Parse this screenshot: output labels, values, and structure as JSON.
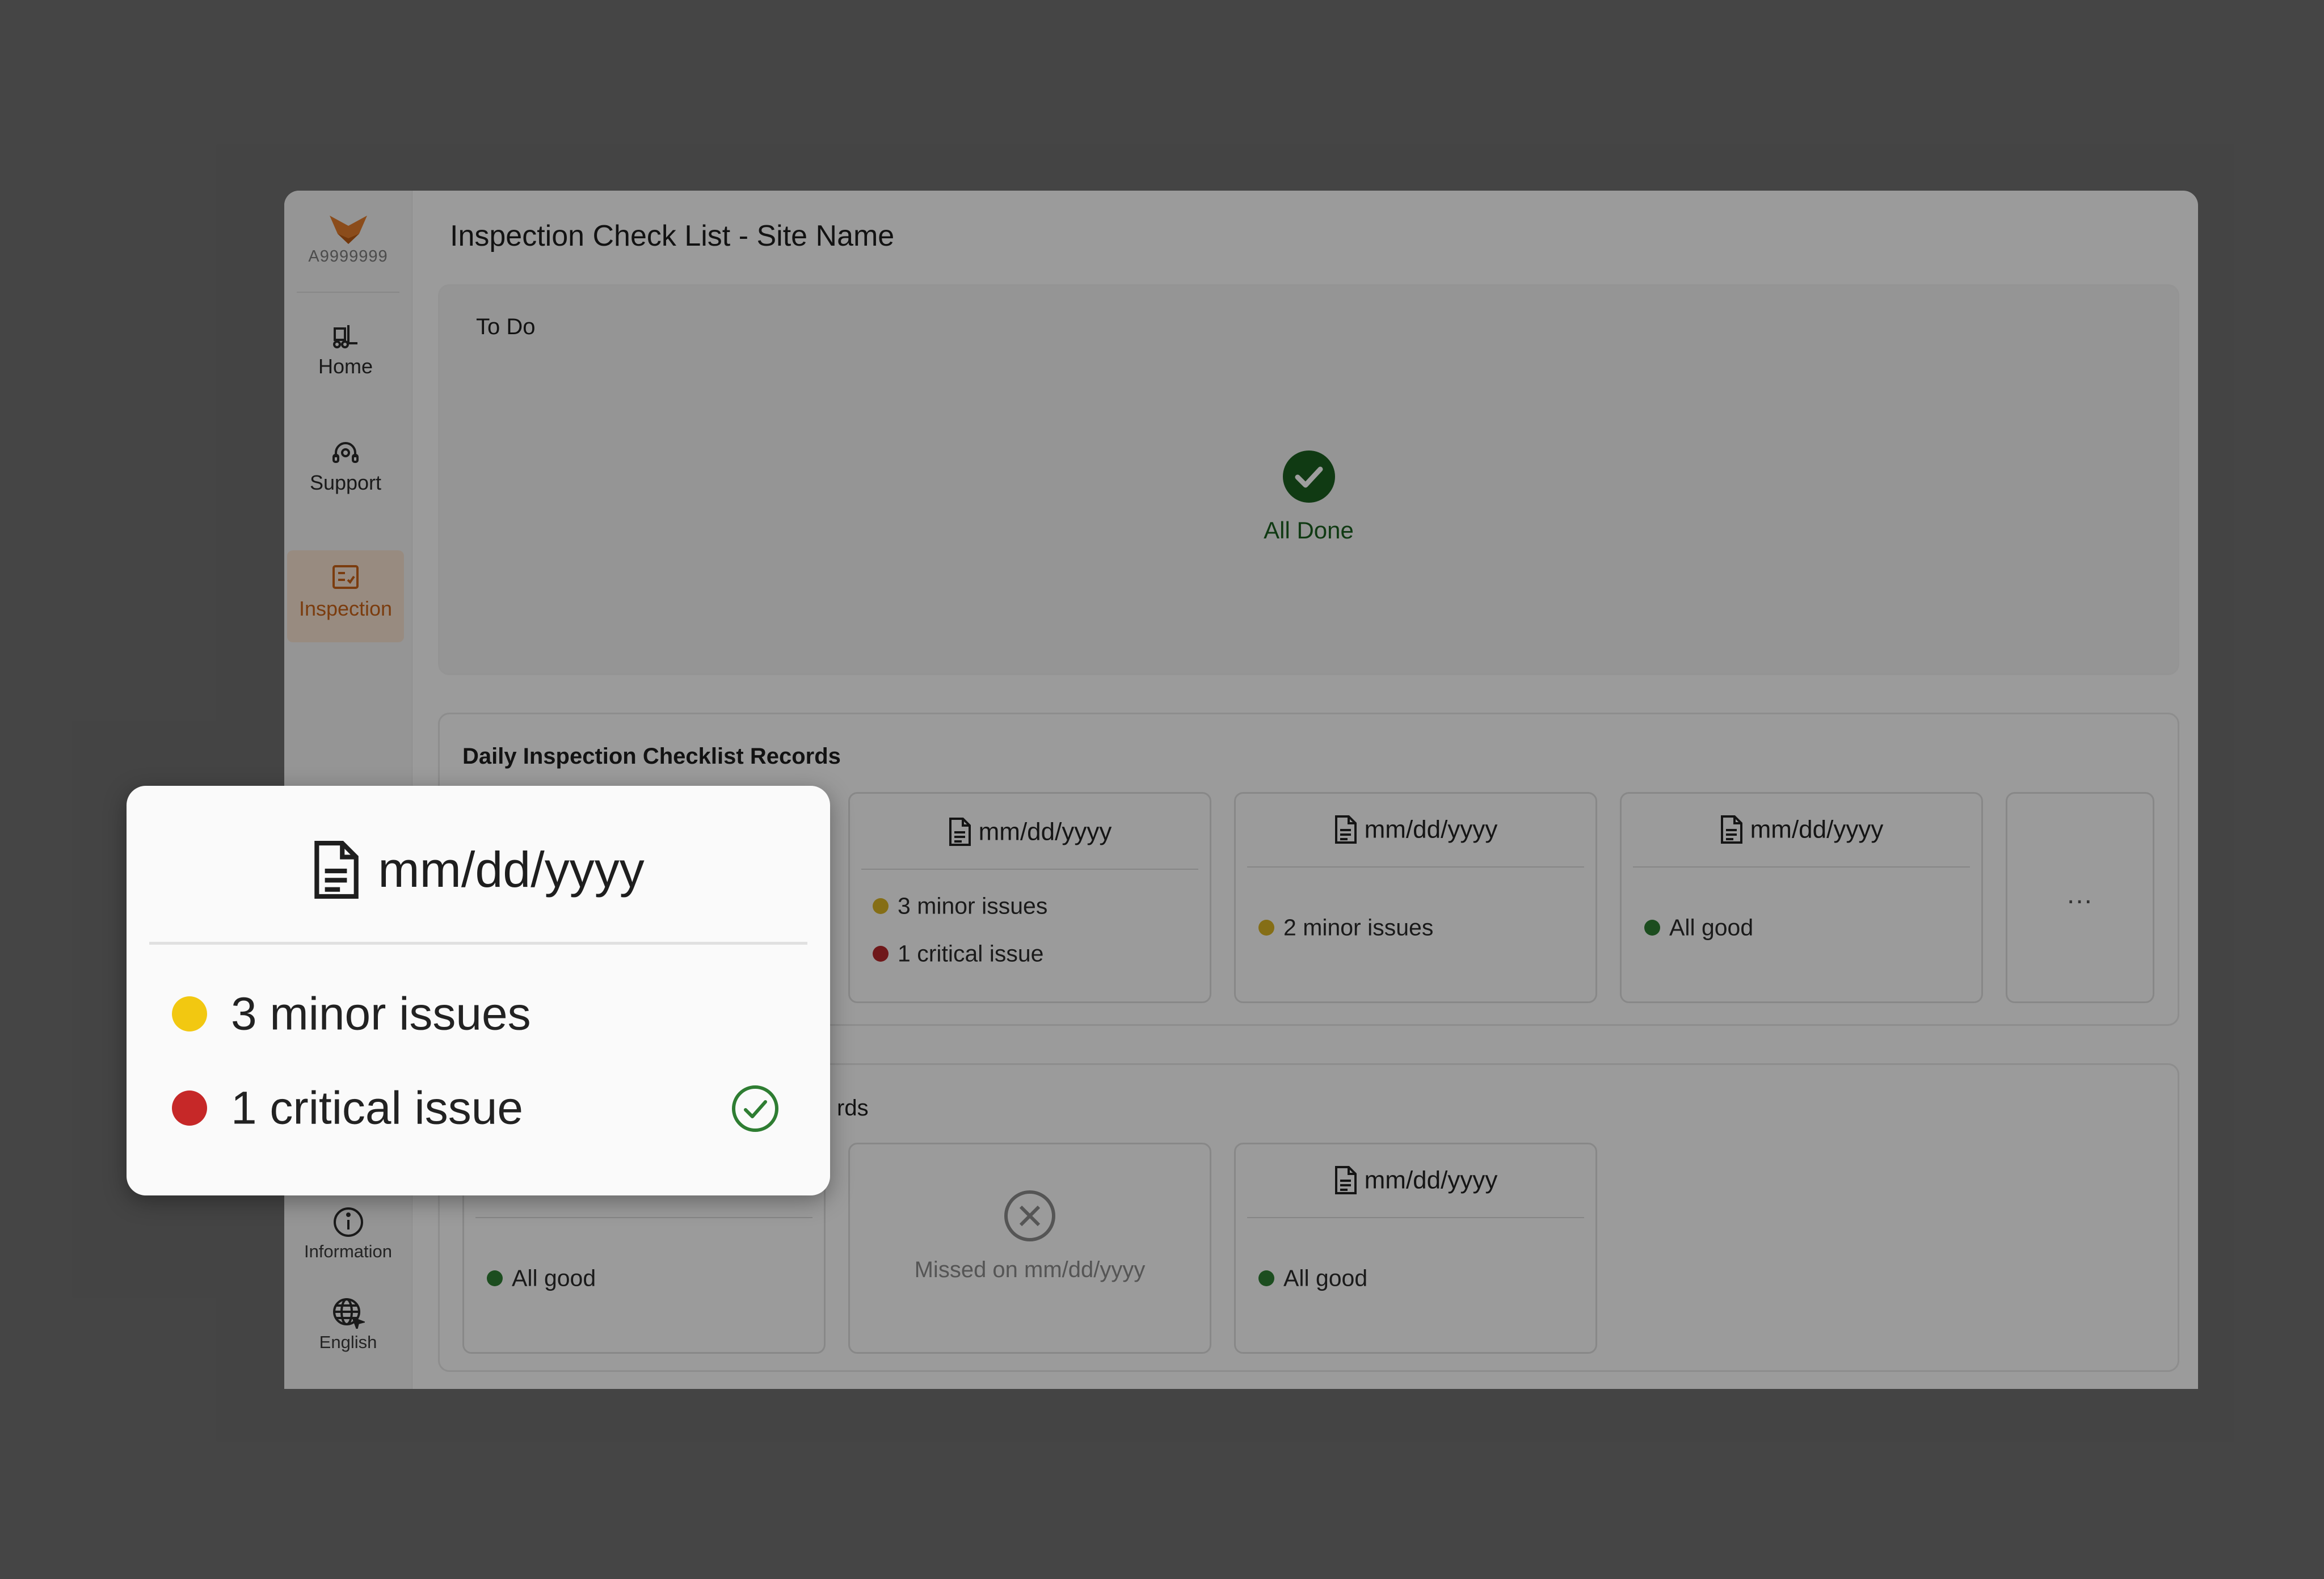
{
  "sidebar": {
    "brand_id": "A9999999",
    "nav": [
      {
        "label": "Home",
        "icon": "forklift-icon"
      },
      {
        "label": "Support",
        "icon": "headset-icon"
      },
      {
        "label": "Inspection",
        "icon": "checklist-icon",
        "active": true
      }
    ],
    "utility": [
      {
        "label": "Information",
        "icon": "info-icon"
      },
      {
        "label": "English",
        "icon": "language-icon"
      }
    ]
  },
  "page": {
    "title": "Inspection Check List - Site Name"
  },
  "todo": {
    "title": "To Do",
    "status": "All Done"
  },
  "daily": {
    "title": "Daily Inspection Checklist Records",
    "cards": [
      {
        "date": "mm/dd/yyyy",
        "issues": [
          {
            "text": "3 minor issues",
            "level": "minor"
          },
          {
            "text": "1 critical issue",
            "level": "critical"
          }
        ]
      },
      {
        "date": "mm/dd/yyyy",
        "issues": [
          {
            "text": "2 minor issues",
            "level": "minor"
          }
        ]
      },
      {
        "date": "mm/dd/yyyy",
        "issues": [
          {
            "text": "All good",
            "level": "good"
          }
        ]
      }
    ],
    "more_label": "..."
  },
  "second": {
    "title_visible": "rds",
    "cards": [
      {
        "status": "All good"
      },
      {
        "missed": "Missed on mm/dd/yyyy"
      },
      {
        "date": "mm/dd/yyyy",
        "status": "All good"
      }
    ]
  },
  "popup": {
    "date": "mm/dd/yyyy",
    "issues": [
      {
        "text": "3 minor issues",
        "level": "minor"
      },
      {
        "text": "1 critical issue",
        "level": "critical",
        "resolved": true
      }
    ]
  },
  "colors": {
    "accent": "#c76118",
    "minor": "#f2c811",
    "critical": "#c62828",
    "good": "#2e7d32",
    "done": "#1b5e20"
  }
}
